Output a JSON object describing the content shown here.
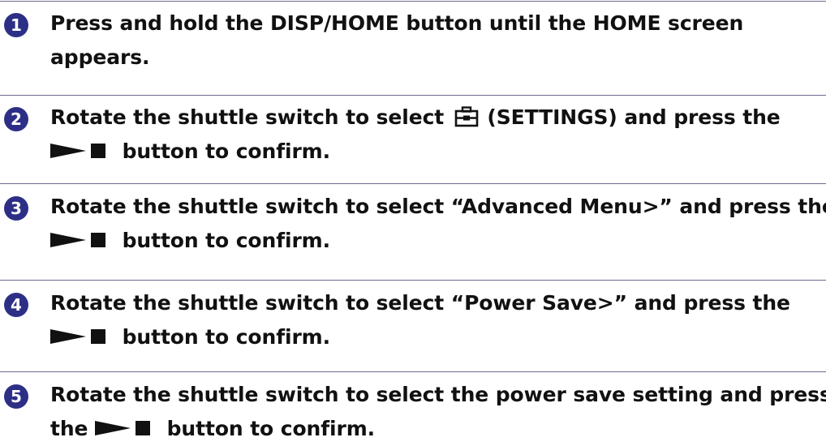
{
  "steps": [
    {
      "number": "1",
      "line1": "Press and hold the DISP/HOME button until the HOME screen",
      "line2": "appears."
    },
    {
      "number": "2",
      "line1_before": "Rotate the shuttle switch to select",
      "line1_after": "(SETTINGS) and press the",
      "line2_after": "button to confirm.",
      "icon": "settings-toolbox-icon"
    },
    {
      "number": "3",
      "line1": "Rotate the shuttle switch to select “Advanced Menu>” and press the",
      "line2_after": "button to confirm."
    },
    {
      "number": "4",
      "line1": "Rotate the shuttle switch to select “Power Save>” and press the",
      "line2_after": "button to confirm."
    },
    {
      "number": "5",
      "line1": "Rotate the shuttle switch to select the power save setting and press",
      "line2_before": "the",
      "line2_after": "button to confirm."
    }
  ],
  "icons": {
    "button_symbol": "play-stop-icon",
    "step_marker_color": "#2d2f86",
    "divider_color": "#6b6b8f"
  }
}
